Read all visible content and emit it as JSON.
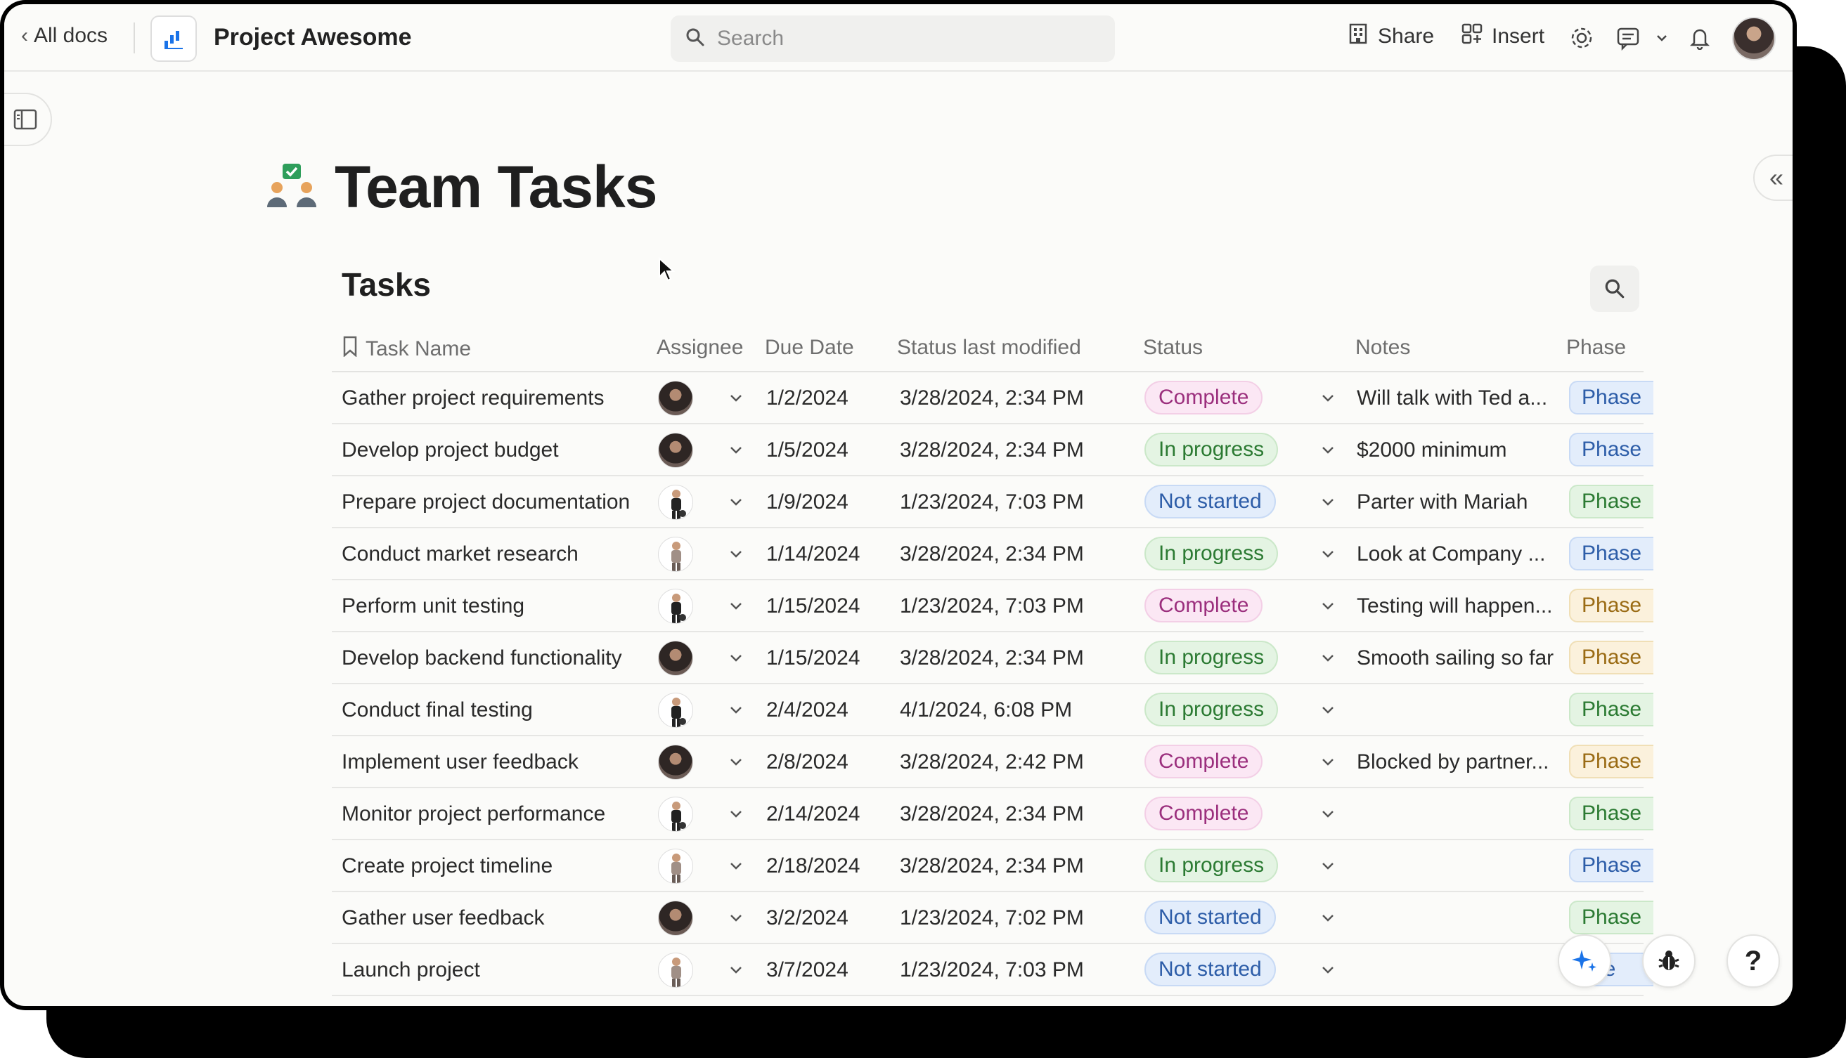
{
  "topbar": {
    "back_label": "All docs",
    "doc_title": "Project Awesome",
    "search_placeholder": "Search",
    "share_label": "Share",
    "insert_label": "Insert"
  },
  "page": {
    "title": "Team Tasks"
  },
  "table": {
    "title": "Tasks",
    "columns": [
      "Task Name",
      "Assignee",
      "Due Date",
      "Status last modified",
      "Status",
      "Notes",
      "Phase"
    ],
    "rows": [
      {
        "task": "Gather project requirements",
        "assignee": "dark",
        "due": "1/2/2024",
        "modified": "3/28/2024, 2:34 PM",
        "status": "Complete",
        "notes": "Will talk with Ted a...",
        "phase": "Phase",
        "phase_color": "blue"
      },
      {
        "task": "Develop project budget",
        "assignee": "dark",
        "due": "1/5/2024",
        "modified": "3/28/2024, 2:34 PM",
        "status": "In progress",
        "notes": "$2000 minimum",
        "phase": "Phase",
        "phase_color": "blue"
      },
      {
        "task": "Prepare project documentation",
        "assignee": "figure-dark",
        "due": "1/9/2024",
        "modified": "1/23/2024, 7:03 PM",
        "status": "Not started",
        "notes": "Parter with Mariah",
        "phase": "Phase",
        "phase_color": "green"
      },
      {
        "task": "Conduct market research",
        "assignee": "figure-light",
        "due": "1/14/2024",
        "modified": "3/28/2024, 2:34 PM",
        "status": "In progress",
        "notes": "Look at Company ...",
        "phase": "Phase",
        "phase_color": "blue"
      },
      {
        "task": "Perform unit testing",
        "assignee": "figure-dark",
        "due": "1/15/2024",
        "modified": "1/23/2024, 7:03 PM",
        "status": "Complete",
        "notes": "Testing will happen...",
        "phase": "Phase",
        "phase_color": "yellow"
      },
      {
        "task": "Develop backend functionality",
        "assignee": "dark",
        "due": "1/15/2024",
        "modified": "3/28/2024, 2:34 PM",
        "status": "In progress",
        "notes": "Smooth sailing so far",
        "phase": "Phase",
        "phase_color": "yellow"
      },
      {
        "task": "Conduct final testing",
        "assignee": "figure-dark",
        "due": "2/4/2024",
        "modified": "4/1/2024, 6:08 PM",
        "status": "In progress",
        "notes": "",
        "phase": "Phase",
        "phase_color": "green"
      },
      {
        "task": "Implement user feedback",
        "assignee": "dark",
        "due": "2/8/2024",
        "modified": "3/28/2024, 2:42 PM",
        "status": "Complete",
        "notes": "Blocked by partner...",
        "phase": "Phase",
        "phase_color": "yellow"
      },
      {
        "task": "Monitor project performance",
        "assignee": "figure-dark",
        "due": "2/14/2024",
        "modified": "3/28/2024, 2:34 PM",
        "status": "Complete",
        "notes": "",
        "phase": "Phase",
        "phase_color": "green"
      },
      {
        "task": "Create project timeline",
        "assignee": "figure-light",
        "due": "2/18/2024",
        "modified": "3/28/2024, 2:34 PM",
        "status": "In progress",
        "notes": "",
        "phase": "Phase",
        "phase_color": "blue"
      },
      {
        "task": "Gather user feedback",
        "assignee": "dark",
        "due": "3/2/2024",
        "modified": "1/23/2024, 7:02 PM",
        "status": "Not started",
        "notes": "",
        "phase": "Phase",
        "phase_color": "green"
      },
      {
        "task": "Launch project",
        "assignee": "figure-light",
        "due": "3/7/2024",
        "modified": "1/23/2024, 7:03 PM",
        "status": "Not started",
        "notes": "",
        "phase": "ase",
        "phase_color": "blue"
      }
    ]
  },
  "fab": {
    "help_label": "?"
  },
  "colors": {
    "complete_bg": "#fbe7f4",
    "in_progress_bg": "#e4f4e3",
    "not_started_bg": "#e3edfb",
    "accent_blue": "#1a73e8"
  }
}
